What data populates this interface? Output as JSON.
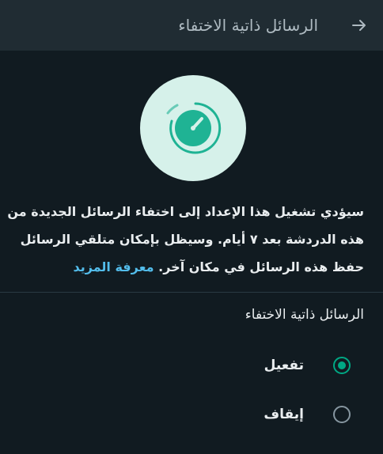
{
  "header": {
    "title": "الرسائل ذاتية الاختفاء",
    "back_icon": "arrow-right-icon"
  },
  "hero": {
    "icon": "timer-icon",
    "colors": {
      "circle_bg": "#d6f1ea",
      "accent": "#1fb394"
    }
  },
  "description": {
    "line1": "سيؤدي تشغيل هذا الإعداد إلى اختفاء الرسائل الجديدة من",
    "line2": "هذه الدردشة بعد ٧ أيام. وسيظل بإمكان متلقي الرسائل",
    "line3": "حفظ هذه الرسائل في مكان آخر.",
    "link": "معرفة المزيد"
  },
  "section": {
    "title": "الرسائل ذاتية الاختفاء"
  },
  "options": [
    {
      "label": "تفعيل",
      "selected": true
    },
    {
      "label": "إيقاف",
      "selected": false
    }
  ],
  "colors": {
    "background": "#111b21",
    "header": "#202c33",
    "accent": "#00a884",
    "link": "#53bdeb"
  }
}
